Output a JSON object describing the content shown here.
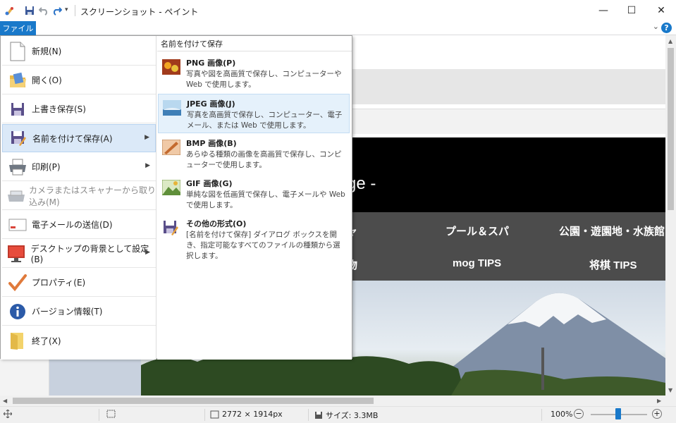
{
  "window": {
    "title": "スクリーンショット - ペイント",
    "minimize_glyph": "—",
    "maximize_glyph": "☐",
    "close_glyph": "✕"
  },
  "ribbon": {
    "file_tab": "ファイル",
    "help_glyph": "?",
    "collapse_glyph": "⌄"
  },
  "file_menu": {
    "items": [
      {
        "label": "新規(N)",
        "icon": "new-document-icon"
      },
      {
        "label": "開く(O)",
        "icon": "open-folder-icon"
      },
      {
        "label": "上書き保存(S)",
        "icon": "save-icon"
      },
      {
        "label": "名前を付けて保存(A)",
        "icon": "save-as-icon",
        "active": true,
        "has_submenu": true
      },
      {
        "label": "印刷(P)",
        "icon": "printer-icon",
        "has_submenu": true
      },
      {
        "label": "カメラまたはスキャナーから取り込み(M)",
        "icon": "scanner-icon",
        "disabled": true
      },
      {
        "label": "電子メールの送信(D)",
        "icon": "email-icon"
      },
      {
        "label": "デスクトップの背景として設定(B)",
        "icon": "desktop-background-icon",
        "has_submenu": true
      },
      {
        "label": "プロパティ(E)",
        "icon": "properties-check-icon"
      },
      {
        "label": "バージョン情報(T)",
        "icon": "info-icon"
      },
      {
        "label": "終了(X)",
        "icon": "exit-icon"
      }
    ],
    "submenu": {
      "header": "名前を付けて保存",
      "items": [
        {
          "title": "PNG 画像(P)",
          "desc": "写真や図を高画質で保存し、コンピューターや Web で使用します。",
          "icon": "png-image-icon"
        },
        {
          "title": "JPEG 画像(J)",
          "desc": "写真を高画質で保存し、コンピューター、電子メール、または Web で使用します。",
          "icon": "jpeg-image-icon",
          "active": true
        },
        {
          "title": "BMP 画像(B)",
          "desc": "あらゆる種類の画像を高画質で保存し、コンピューターで使用します。",
          "icon": "bmp-image-icon"
        },
        {
          "title": "GIF 画像(G)",
          "desc": "単純な図を低画質で保存し、電子メールや Web で使用します。",
          "icon": "gif-image-icon"
        },
        {
          "title": "その他の形式(O)",
          "desc": "[名前を付けて保存] ダイアログ ボックスを開き、指定可能なすべてのファイルの種類から選択します。",
          "icon": "other-formats-icon"
        }
      ]
    }
  },
  "canvas": {
    "banner_text": "ge -",
    "nav_row1": [
      "ャ",
      "プール＆スパ",
      "公園・遊園地・水族館"
    ],
    "nav_row2": [
      "物",
      "mog TIPS",
      "将棋 TIPS"
    ]
  },
  "status": {
    "dimensions": "2772 × 1914px",
    "size": "サイズ: 3.3MB",
    "zoom": "100%",
    "zoom_level_percent": 100,
    "zoom_out": "−",
    "zoom_in": "+"
  },
  "colors": {
    "accent": "#1979ca",
    "menu_active": "#dbe9f8"
  }
}
